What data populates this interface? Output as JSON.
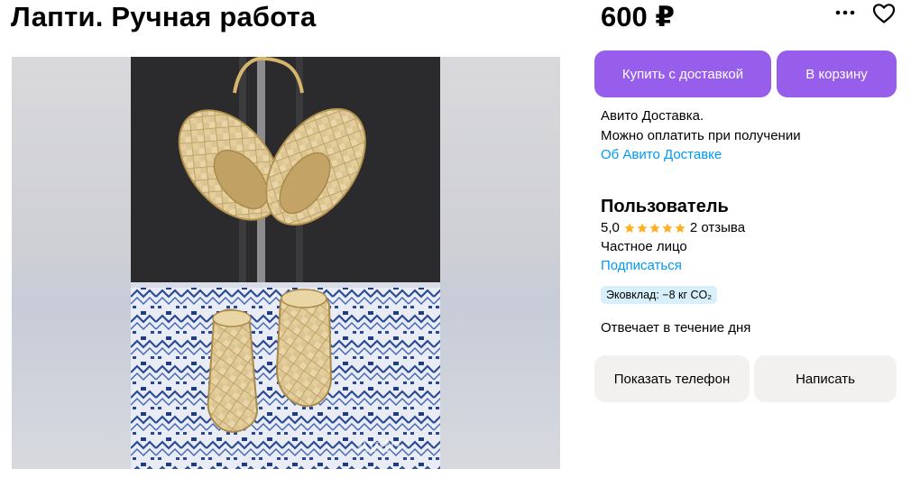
{
  "listing": {
    "title": "Лапти. Ручная работа",
    "price": "600 ₽"
  },
  "icons": {
    "more": "more-dots-icon",
    "favorite": "heart-outline-icon",
    "star": "star-icon"
  },
  "gallery": {
    "watermark": "Avito"
  },
  "actions": {
    "buy_label": "Купить с доставкой",
    "cart_label": "В корзину",
    "phone_label": "Показать телефон",
    "write_label": "Написать"
  },
  "delivery": {
    "line1": "Авито Доставка.",
    "line2": "Можно оплатить при получении",
    "link": "Об Авито Доставке"
  },
  "seller": {
    "name": "Пользователь",
    "rating": "5,0",
    "stars": 5,
    "reviews": "2 отзыва",
    "type": "Частное лицо",
    "subscribe": "Подписаться",
    "eco": "Эковклад: −8 кг CO₂",
    "response": "Отвечает в течение дня"
  },
  "colors": {
    "accent": "#965eeb",
    "link": "#0099f7",
    "star": "#ffb021",
    "eco_bg": "#d7f0fb",
    "gray_button": "#f2f1f0"
  }
}
